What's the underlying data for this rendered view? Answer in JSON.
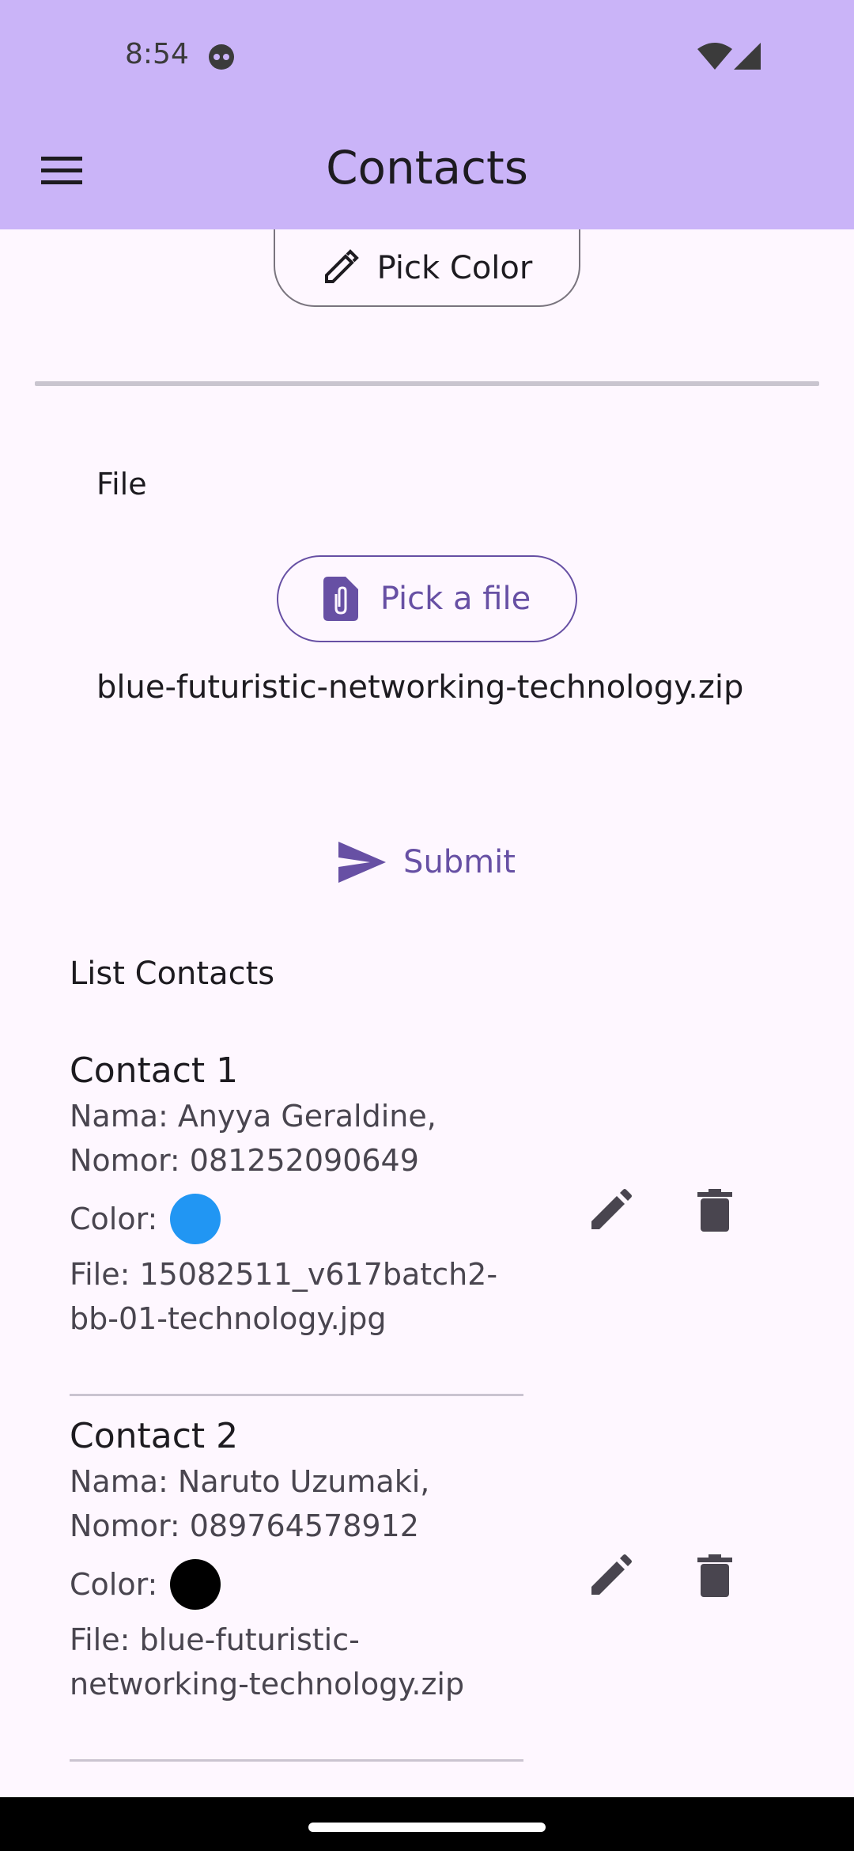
{
  "status_bar": {
    "time": "8:54"
  },
  "app_bar": {
    "title": "Contacts"
  },
  "form": {
    "pick_color_label": "Pick Color",
    "file_label": "File",
    "pick_file_label": "Pick a file",
    "selected_file": "blue-futuristic-networking-technology.zip",
    "submit_label": "Submit"
  },
  "list": {
    "title": "List Contacts",
    "contacts": [
      {
        "title": "Contact 1",
        "nama_line": "Nama: Anyya Geraldine,",
        "nomor_line": "Nomor: 081252090649",
        "color_label": "Color:",
        "color": "#2196f3",
        "file_line1": "File: 15082511_v617batch2-",
        "file_line2": "bb-01-technology.jpg"
      },
      {
        "title": "Contact 2",
        "nama_line": "Nama: Naruto Uzumaki,",
        "nomor_line": "Nomor: 089764578912",
        "color_label": "Color:",
        "color": "#000000",
        "file_line1": "File: blue-futuristic-",
        "file_line2": "networking-technology.zip"
      }
    ]
  },
  "colors": {
    "app_bar": "#cab4f8",
    "primary": "#6750a4",
    "background": "#fef7ff"
  }
}
